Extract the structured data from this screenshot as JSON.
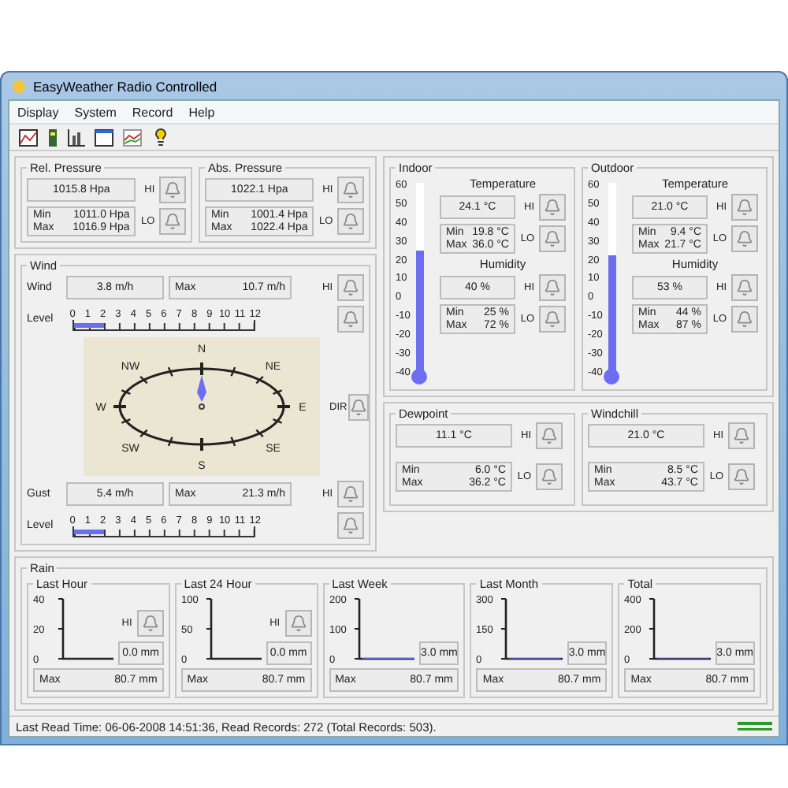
{
  "window": {
    "title": "EasyWeather Radio Controlled"
  },
  "menu": [
    {
      "label": "Display"
    },
    {
      "label": "System"
    },
    {
      "label": "Record"
    },
    {
      "label": "Help"
    }
  ],
  "pressure": [
    {
      "title": "Rel. Pressure",
      "value": "1015.8 Hpa",
      "hi": "HI",
      "lo": "LO",
      "min_label": "Min",
      "min": "1011.0 Hpa",
      "max_label": "Max",
      "max": "1016.9 Hpa"
    },
    {
      "title": "Abs. Pressure",
      "value": "1022.1 Hpa",
      "hi": "HI",
      "lo": "LO",
      "min_label": "Min",
      "min": "1001.4 Hpa",
      "max_label": "Max",
      "max": "1022.4 Hpa"
    }
  ],
  "wind": {
    "title": "Wind",
    "readings": [
      {
        "label": "Wind",
        "value": "3.8 m/h",
        "max_label": "Max",
        "max": "10.7 m/h",
        "hi": "HI",
        "level_label": "Level",
        "scale": [
          "0",
          "1",
          "2",
          "3",
          "4",
          "5",
          "6",
          "7",
          "8",
          "9",
          "10",
          "11",
          "12"
        ],
        "level": 0.1667
      },
      {
        "label": "Gust",
        "value": "5.4 m/h",
        "max_label": "Max",
        "max": "21.3 m/h",
        "hi": "HI",
        "level_label": "Level",
        "scale": [
          "0",
          "1",
          "2",
          "3",
          "4",
          "5",
          "6",
          "7",
          "8",
          "9",
          "10",
          "11",
          "12"
        ],
        "level": 0.1667
      }
    ],
    "compass": {
      "points": [
        "N",
        "NE",
        "E",
        "SE",
        "S",
        "SW",
        "W",
        "NW"
      ],
      "dir": "DIR"
    }
  },
  "climate": [
    {
      "title": "Indoor",
      "scale": [
        "60",
        "50",
        "40",
        "30",
        "20",
        "10",
        "0",
        "-10",
        "-20",
        "-30",
        "-40"
      ],
      "level": 0.64,
      "temperature": {
        "label": "Temperature",
        "value": "24.1 °C",
        "hi": "HI",
        "lo": "LO",
        "min_label": "Min",
        "min": "19.8 °C",
        "max_label": "Max",
        "max": "36.0 °C"
      },
      "humidity": {
        "label": "Humidity",
        "value": "40 %",
        "hi": "HI",
        "lo": "LO",
        "min_label": "Min",
        "min": "25 %",
        "max_label": "Max",
        "max": "72 %"
      }
    },
    {
      "title": "Outdoor",
      "scale": [
        "60",
        "50",
        "40",
        "30",
        "20",
        "10",
        "0",
        "-10",
        "-20",
        "-30",
        "-40"
      ],
      "level": 0.61,
      "temperature": {
        "label": "Temperature",
        "value": "21.0 °C",
        "hi": "HI",
        "lo": "LO",
        "min_label": "Min",
        "min": "9.4 °C",
        "max_label": "Max",
        "max": "21.7 °C"
      },
      "humidity": {
        "label": "Humidity",
        "value": "53 %",
        "hi": "HI",
        "lo": "LO",
        "min_label": "Min",
        "min": "44 %",
        "max_label": "Max",
        "max": "87 %"
      }
    }
  ],
  "derived": [
    {
      "title": "Dewpoint",
      "value": "11.1 °C",
      "hi": "HI",
      "lo": "LO",
      "min_label": "Min",
      "min": "6.0 °C",
      "max_label": "Max",
      "max": "36.2 °C"
    },
    {
      "title": "Windchill",
      "value": "21.0 °C",
      "hi": "HI",
      "lo": "LO",
      "min_label": "Min",
      "min": "8.5 °C",
      "max_label": "Max",
      "max": "43.7 °C"
    }
  ],
  "rain": {
    "title": "Rain",
    "panels": [
      {
        "title": "Last Hour",
        "hi": "HI",
        "value": "0.0 mm",
        "max_label": "Max",
        "max": "80.7 mm",
        "chart_data": {
          "type": "bar",
          "ylim": [
            0,
            40
          ],
          "yticks": [
            0,
            20,
            40
          ],
          "values": [
            0
          ]
        }
      },
      {
        "title": "Last 24 Hour",
        "hi": "HI",
        "value": "0.0 mm",
        "max_label": "Max",
        "max": "80.7 mm",
        "chart_data": {
          "type": "bar",
          "ylim": [
            0,
            100
          ],
          "yticks": [
            0,
            50,
            100
          ],
          "values": [
            0
          ]
        }
      },
      {
        "title": "Last Week",
        "value": "3.0 mm",
        "max_label": "Max",
        "max": "80.7 mm",
        "chart_data": {
          "type": "bar",
          "ylim": [
            0,
            200
          ],
          "yticks": [
            0,
            100,
            200
          ],
          "values": [
            3
          ]
        }
      },
      {
        "title": "Last Month",
        "value": "3.0 mm",
        "max_label": "Max",
        "max": "80.7 mm",
        "chart_data": {
          "type": "bar",
          "ylim": [
            0,
            300
          ],
          "yticks": [
            0,
            150,
            300
          ],
          "values": [
            3
          ]
        }
      },
      {
        "title": "Total",
        "value": "3.0 mm",
        "max_label": "Max",
        "max": "80.7 mm",
        "chart_data": {
          "type": "bar",
          "ylim": [
            0,
            400
          ],
          "yticks": [
            0,
            200,
            400
          ],
          "values": [
            3
          ]
        }
      }
    ]
  },
  "status_bar": {
    "text": "Last Read Time: 06-06-2008 14:51:36, Read Records: 272 (Total Records: 503)."
  }
}
